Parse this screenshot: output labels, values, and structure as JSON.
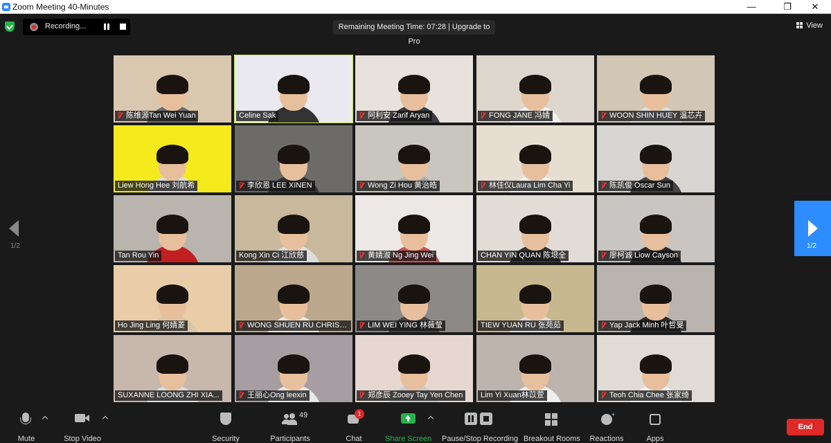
{
  "window": {
    "title": "Zoom Meeting 40-Minutes",
    "minimize": "—",
    "restore": "❐",
    "close": "✕"
  },
  "topbar": {
    "recording_label": "Recording...",
    "timer_text": "Remaining Meeting Time: 07:28 | Upgrade to Pro",
    "view_label": "View"
  },
  "pager": {
    "left_label": "1/2",
    "right_label": "1/2"
  },
  "participants": [
    {
      "name": "陈维源Tan Wei Yuan",
      "muted": true
    },
    {
      "name": "Celine Sak",
      "muted": false,
      "active_speaker": true
    },
    {
      "name": "阿利安 Zarif Aryan",
      "muted": true
    },
    {
      "name": "FONG JANE 冯婧",
      "muted": true
    },
    {
      "name": "WOON SHIN HUEY 温芯卉",
      "muted": true
    },
    {
      "name": "Liew Hong Hee 刘航希",
      "muted": false
    },
    {
      "name": "李欣恩 LEE XINEN",
      "muted": true
    },
    {
      "name": "Wong Zi Hou 黄治皓",
      "muted": true
    },
    {
      "name": "林佳仪Laura Lim Cha Yi",
      "muted": true
    },
    {
      "name": "陈凯俊 Oscar Sun",
      "muted": true
    },
    {
      "name": "Tan Rou Yin",
      "muted": false
    },
    {
      "name": "Kong Xin Ci 江欣慈",
      "muted": false
    },
    {
      "name": "黄婧淑 Ng Jing Wei",
      "muted": true
    },
    {
      "name": "CHAN YIN QUAN 陈垠全",
      "muted": false
    },
    {
      "name": "廖柯诚 Liow Cayson",
      "muted": true
    },
    {
      "name": "Ho Jing Ling 何婧菱",
      "muted": false
    },
    {
      "name": "WONG SHUEN RU CHRISA...",
      "muted": true
    },
    {
      "name": "LIM WEI YING 林薇莹",
      "muted": true
    },
    {
      "name": "TIEW YUAN RU 张苑茹",
      "muted": false
    },
    {
      "name": "Yap Jack Minh 叶哲旻",
      "muted": true
    },
    {
      "name": "SUXANNE LOONG ZHI XIA...",
      "muted": false
    },
    {
      "name": "王丽心Ong leexin",
      "muted": true
    },
    {
      "name": "郑彦辰 Zooey Tay Yen Chen",
      "muted": true
    },
    {
      "name": "Lim Yi Xuan林苡萱",
      "muted": false
    },
    {
      "name": "Teoh Chia Chee 张家绮",
      "muted": true
    }
  ],
  "toolbar": {
    "mute": "Mute",
    "stop_video": "Stop Video",
    "security": "Security",
    "participants": "Participants",
    "participants_count": "49",
    "chat": "Chat",
    "chat_badge": "1",
    "share_screen": "Share Screen",
    "pause_stop_recording": "Pause/Stop Recording",
    "breakout_rooms": "Breakout Rooms",
    "reactions": "Reactions",
    "apps": "Apps",
    "end": "End"
  },
  "colors": {
    "accent": "#2d8cff",
    "share_green": "#24b24b",
    "end_red": "#e02828",
    "active_outline": "#c7e84f"
  }
}
